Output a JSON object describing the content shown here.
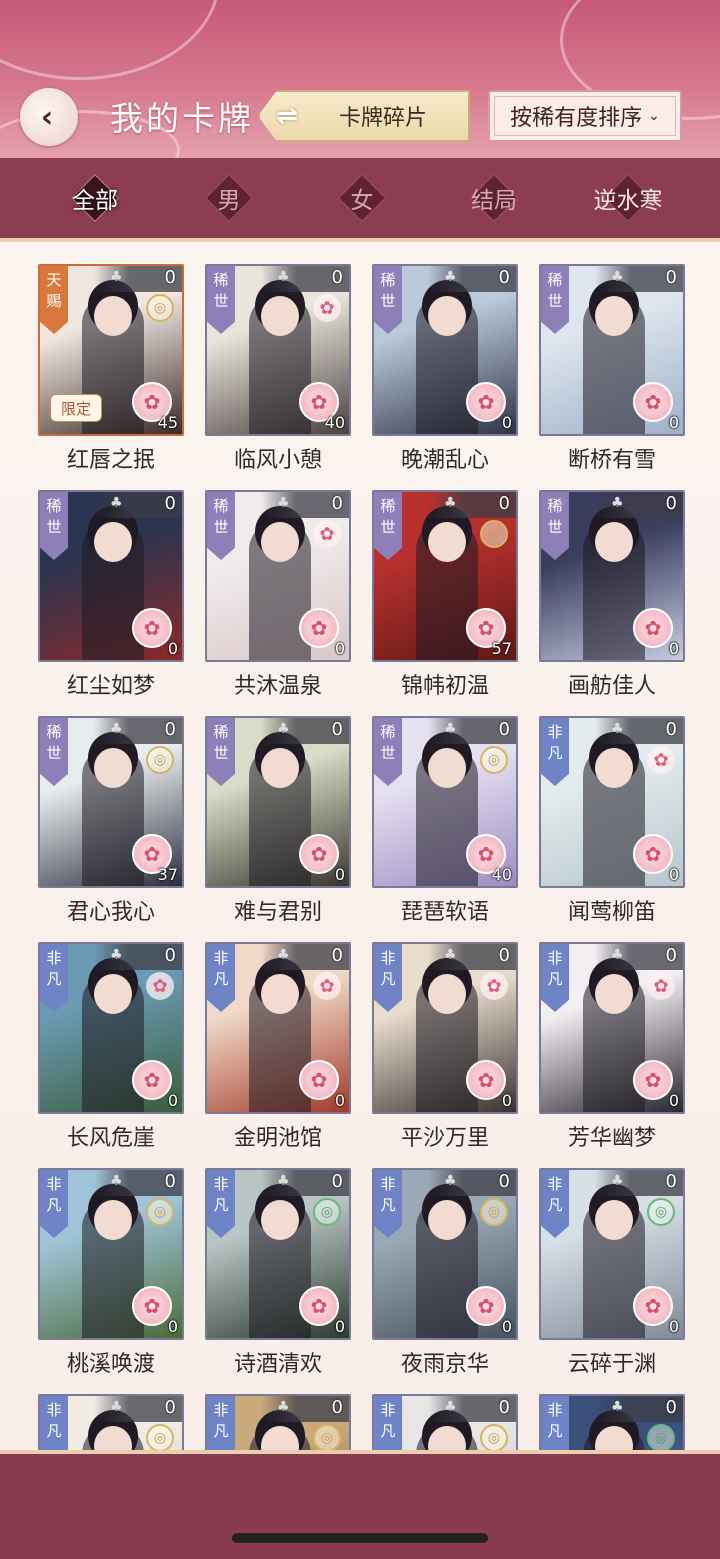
{
  "header": {
    "title": "我的卡牌",
    "swap_button": "卡牌碎片",
    "sort_button": "按稀有度排序",
    "sort_caret": "⌄"
  },
  "filters": [
    "全部",
    "男",
    "女",
    "结局",
    "逆水寒"
  ],
  "active_filter": "全部",
  "cards": [
    {
      "name": "红唇之抿",
      "rarity": "天赐",
      "count": "0",
      "fragments": "45",
      "badge": "coin",
      "limited": "限定",
      "colors": [
        "#efe6df",
        "#3b2a2a"
      ]
    },
    {
      "name": "临风小憩",
      "rarity": "稀世",
      "count": "0",
      "fragments": "40",
      "badge": "flower",
      "colors": [
        "#e9e4dc",
        "#4b4140"
      ]
    },
    {
      "name": "晚潮乱心",
      "rarity": "稀世",
      "count": "0",
      "fragments": "0",
      "badge": "",
      "colors": [
        "#b9c9d9",
        "#2f3346"
      ]
    },
    {
      "name": "断桥有雪",
      "rarity": "稀世",
      "count": "0",
      "fragments": "0",
      "badge": "",
      "colors": [
        "#dfe6ef",
        "#9fb0c8"
      ]
    },
    {
      "name": "红尘如梦",
      "rarity": "稀世",
      "count": "0",
      "fragments": "0",
      "badge": "",
      "colors": [
        "#2b3450",
        "#8a2a2a"
      ]
    },
    {
      "name": "共沐温泉",
      "rarity": "稀世",
      "count": "0",
      "fragments": "0",
      "badge": "flower",
      "colors": [
        "#f1ecec",
        "#d9c6c8"
      ]
    },
    {
      "name": "锦帏初温",
      "rarity": "稀世",
      "count": "0",
      "fragments": "57",
      "badge": "coin",
      "colors": [
        "#b8312f",
        "#5e1815"
      ]
    },
    {
      "name": "画舫佳人",
      "rarity": "稀世",
      "count": "0",
      "fragments": "0",
      "badge": "",
      "colors": [
        "#3b3d5e",
        "#c7cce0"
      ]
    },
    {
      "name": "君心我心",
      "rarity": "稀世",
      "count": "0",
      "fragments": "37",
      "badge": "coin",
      "colors": [
        "#e7ecef",
        "#2c2f3a"
      ]
    },
    {
      "name": "难与君别",
      "rarity": "稀世",
      "count": "0",
      "fragments": "0",
      "badge": "",
      "colors": [
        "#d9dcc8",
        "#39352f"
      ]
    },
    {
      "name": "琵琶软语",
      "rarity": "稀世",
      "count": "0",
      "fragments": "40",
      "badge": "coin",
      "colors": [
        "#e6e1f1",
        "#9c8dc4"
      ]
    },
    {
      "name": "闻莺柳笛",
      "rarity": "非凡",
      "count": "0",
      "fragments": "0",
      "badge": "flower",
      "colors": [
        "#e3ebee",
        "#b7c7cc"
      ]
    },
    {
      "name": "长风危崖",
      "rarity": "非凡",
      "count": "0",
      "fragments": "0",
      "badge": "flower",
      "colors": [
        "#6b9ab3",
        "#3a5c3a"
      ]
    },
    {
      "name": "金明池馆",
      "rarity": "非凡",
      "count": "0",
      "fragments": "0",
      "badge": "flower",
      "colors": [
        "#f0d9c8",
        "#a23a2a"
      ]
    },
    {
      "name": "平沙万里",
      "rarity": "非凡",
      "count": "0",
      "fragments": "0",
      "badge": "flower",
      "colors": [
        "#e8dccd",
        "#3b3230"
      ]
    },
    {
      "name": "芳华幽梦",
      "rarity": "非凡",
      "count": "0",
      "fragments": "0",
      "badge": "flower",
      "colors": [
        "#f2eef2",
        "#2a262e"
      ]
    },
    {
      "name": "桃溪唤渡",
      "rarity": "非凡",
      "count": "0",
      "fragments": "0",
      "badge": "coin",
      "colors": [
        "#9fc4d8",
        "#4a6b3a"
      ]
    },
    {
      "name": "诗酒清欢",
      "rarity": "非凡",
      "count": "0",
      "fragments": "0",
      "badge": "jade",
      "colors": [
        "#b9c4c4",
        "#2c3a2e"
      ]
    },
    {
      "name": "夜雨京华",
      "rarity": "非凡",
      "count": "0",
      "fragments": "0",
      "badge": "coin",
      "colors": [
        "#9aa9b5",
        "#46525e"
      ]
    },
    {
      "name": "云碎于渊",
      "rarity": "非凡",
      "count": "0",
      "fragments": "0",
      "badge": "jade",
      "colors": [
        "#d6dee6",
        "#7f8b98"
      ]
    },
    {
      "name": "",
      "rarity": "非凡",
      "count": "0",
      "fragments": "",
      "badge": "coin",
      "colors": [
        "#f1ebe3",
        "#c9b9a6"
      ]
    },
    {
      "name": "",
      "rarity": "非凡",
      "count": "0",
      "fragments": "",
      "badge": "coin",
      "colors": [
        "#c9a97c",
        "#7b5a3a"
      ]
    },
    {
      "name": "",
      "rarity": "非凡",
      "count": "0",
      "fragments": "",
      "badge": "coin",
      "colors": [
        "#e9e6e6",
        "#b9b3b3"
      ]
    },
    {
      "name": "",
      "rarity": "非凡",
      "count": "0",
      "fragments": "",
      "badge": "jade",
      "colors": [
        "#3a4f7a",
        "#6c85b0"
      ]
    }
  ]
}
